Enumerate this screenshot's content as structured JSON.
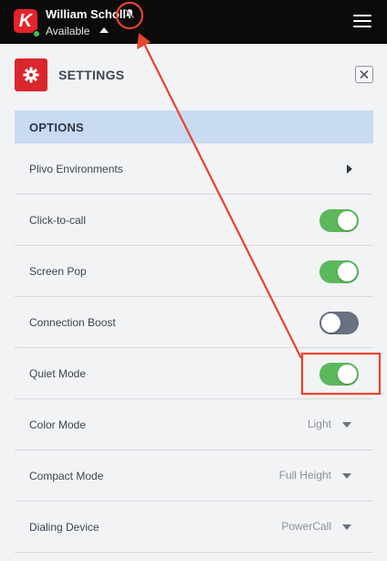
{
  "header": {
    "logo_letter": "K",
    "user_name": "William Scholl",
    "status": "Available",
    "icons": {
      "bell": "bell-off-icon",
      "status_caret": "caret-up-icon",
      "menu": "hamburger-menu-icon"
    },
    "colors": {
      "bar": "#0b0b0b",
      "logo": "#e4232b",
      "presence": "#3cc35a"
    }
  },
  "settings": {
    "title": "SETTINGS",
    "icon": "gear-icon",
    "close_icon": "close-icon"
  },
  "options": {
    "section_label": "OPTIONS",
    "rows": [
      {
        "label": "Plivo Environments",
        "control": "chevron-right-icon"
      },
      {
        "label": "Click-to-call",
        "control": "toggle",
        "enabled": true
      },
      {
        "label": "Screen Pop",
        "control": "toggle",
        "enabled": true
      },
      {
        "label": "Connection Boost",
        "control": "toggle",
        "enabled": false
      },
      {
        "label": "Quiet Mode",
        "control": "toggle",
        "enabled": true
      },
      {
        "label": "Color Mode",
        "control": "select",
        "value": "Light"
      },
      {
        "label": "Compact Mode",
        "control": "select",
        "value": "Full Height"
      },
      {
        "label": "Dialing Device",
        "control": "select",
        "value": "PowerCall"
      }
    ]
  },
  "colors": {
    "toggle_on": "#5cb85c",
    "toggle_off": "#6a7183",
    "options_header": "#c9daf3",
    "annotation": "#e8432d"
  }
}
